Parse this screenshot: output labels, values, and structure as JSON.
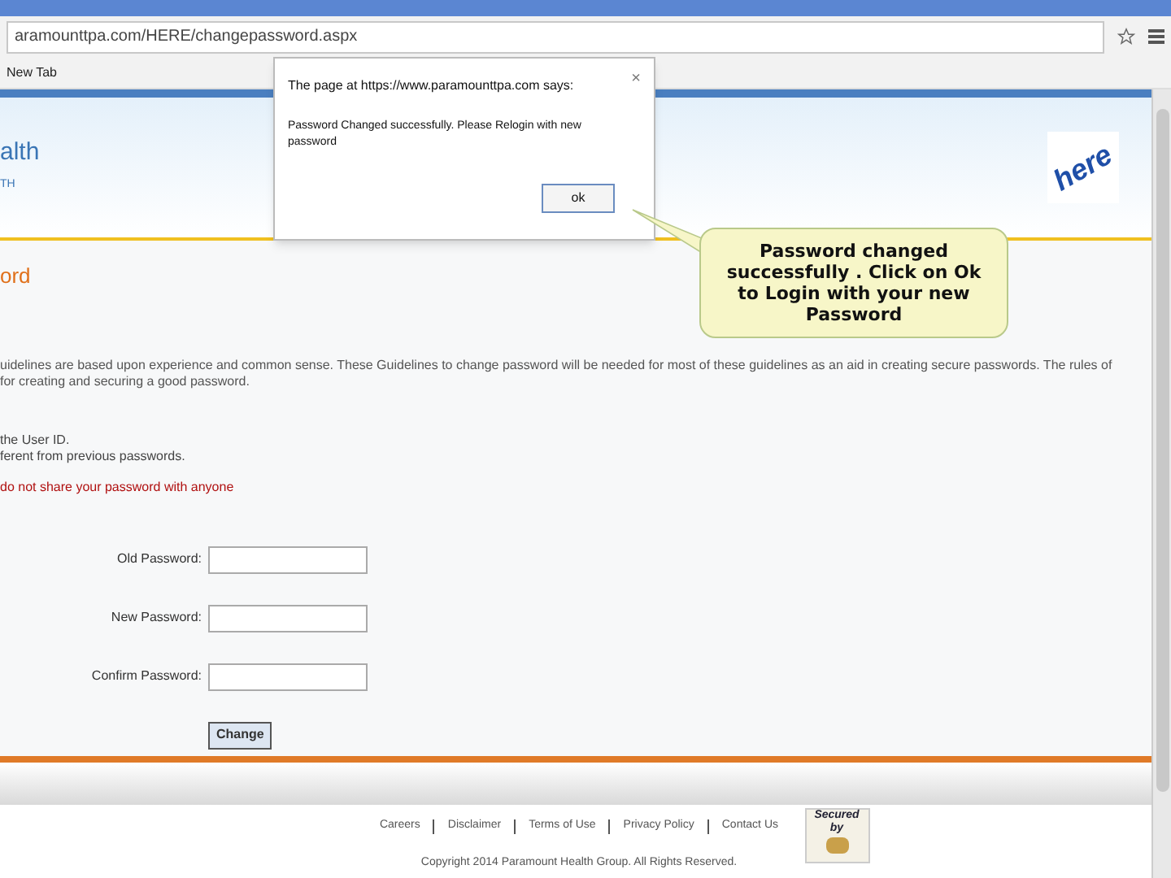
{
  "browser": {
    "url": "aramounttpa.com/HERE/changepassword.aspx",
    "bookmarks": [
      "New Tab"
    ]
  },
  "header": {
    "brand": "alth",
    "brand_sub": "TH",
    "logo": "here"
  },
  "page": {
    "title": "ord",
    "guidelines": [
      "uidelines are based upon experience and common sense. These Guidelines to change password will be needed for most of these guidelines as an aid in creating secure passwords. The rules of",
      "for creating and securing a good password."
    ],
    "rules": [
      "the User ID.",
      "ferent from previous passwords."
    ],
    "warning": "do not share your password with anyone",
    "fields": [
      {
        "label": "Old Password:"
      },
      {
        "label": "New Password:"
      },
      {
        "label": "Confirm Password:"
      }
    ],
    "submit": "Change"
  },
  "dialog": {
    "title": "The page at https://www.paramounttpa.com says:",
    "close": "×",
    "message": "Password Changed successfully. Please Relogin with new password",
    "button": "ok"
  },
  "callout": "Password changed successfully . Click on Ok to Login with your new Password",
  "footer": {
    "links": [
      "Careers",
      "Disclaimer",
      "Terms of Use",
      "Privacy Policy",
      "Contact Us"
    ],
    "copyright": "Copyright 2014 Paramount Health Group. All Rights Reserved.",
    "badge": [
      "Secured",
      "by"
    ]
  }
}
